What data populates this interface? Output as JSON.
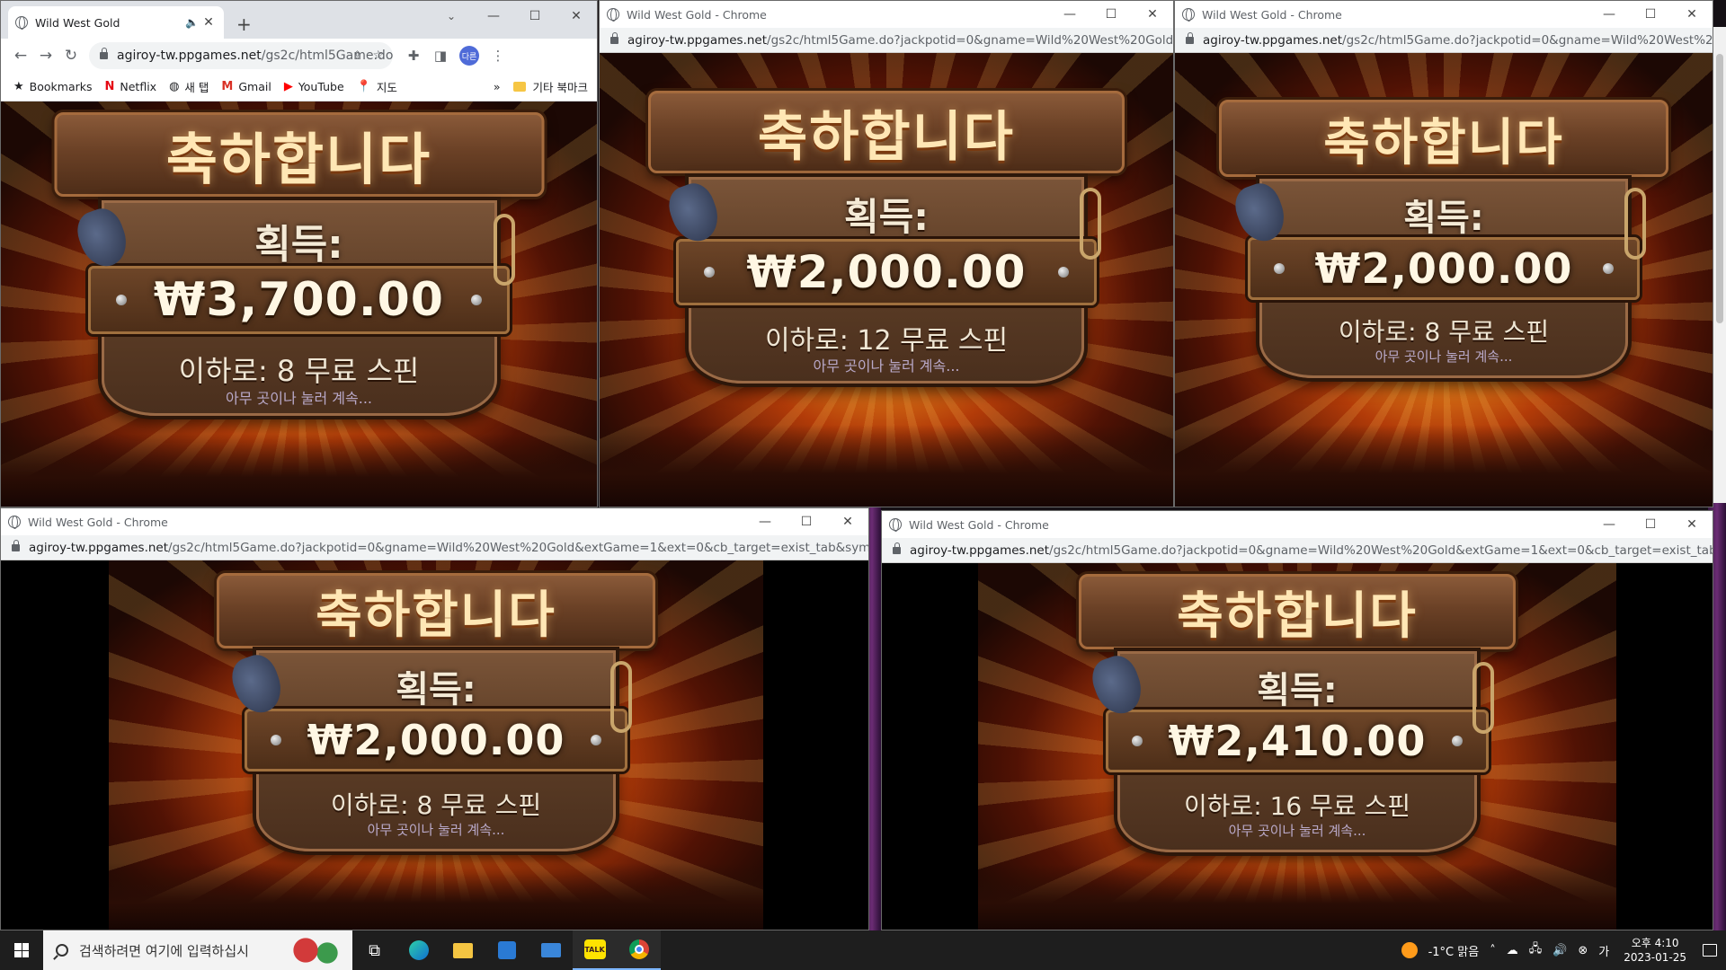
{
  "colors": {
    "taskbar": "#1e1e1e",
    "chrome_frame": "#dee1e6",
    "accent": "#4f6bd8"
  },
  "main_window": {
    "tab_title": "Wild West Gold",
    "url_domain": "agiroy-tw.ppgames.net",
    "url_path": "/gs2c/html5Game.do?ja...",
    "profile_initial": "다른",
    "bookmarks": [
      "Bookmarks",
      "Netflix",
      "새 탭",
      "Gmail",
      "YouTube",
      "지도"
    ],
    "bookmarks_overflow": "»",
    "other_bookmarks": "기타 북마크",
    "game": {
      "title": "축하합니다",
      "gain_label": "획득:",
      "amount": "₩3,700.00",
      "spins": "이하로: 8 무료 스핀",
      "continue": "아무 곳이나 눌러 계속..."
    }
  },
  "popups": [
    {
      "title": "Wild West Gold - Chrome",
      "url_domain": "agiroy-tw.ppgames.net",
      "url_path": "/gs2c/html5Game.do?jackpotid=0&gname=Wild%20West%20Gold...",
      "game": {
        "title": "축하합니다",
        "gain_label": "획득:",
        "amount": "₩2,000.00",
        "spins": "이하로: 12 무료 스핀",
        "continue": "아무 곳이나 눌러 계속..."
      }
    },
    {
      "title": "Wild West Gold - Chrome",
      "url_domain": "agiroy-tw.ppgames.net",
      "url_path": "/gs2c/html5Game.do?jackpotid=0&gname=Wild%20West%2...",
      "game": {
        "title": "축하합니다",
        "gain_label": "획득:",
        "amount": "₩2,000.00",
        "spins": "이하로: 8 무료 스핀",
        "continue": "아무 곳이나 눌러 계속..."
      }
    },
    {
      "title": "Wild West Gold - Chrome",
      "url_domain": "agiroy-tw.ppgames.net",
      "url_path": "/gs2c/html5Game.do?jackpotid=0&gname=Wild%20West%20Gold&extGame=1&ext=0&cb_target=exist_tab&symbol=...",
      "game": {
        "title": "축하합니다",
        "gain_label": "획득:",
        "amount": "₩2,000.00",
        "spins": "이하로: 8 무료 스핀",
        "continue": "아무 곳이나 눌러 계속..."
      }
    },
    {
      "title": "Wild West Gold - Chrome",
      "url_domain": "agiroy-tw.ppgames.net",
      "url_path": "/gs2c/html5Game.do?jackpotid=0&gname=Wild%20West%20Gold&extGame=1&ext=0&cb_target=exist_tab&sy...",
      "game": {
        "title": "축하합니다",
        "gain_label": "획득:",
        "amount": "₩2,410.00",
        "spins": "이하로: 16 무료 스핀",
        "continue": "아무 곳이나 눌러 계속..."
      }
    }
  ],
  "taskbar": {
    "search_placeholder": "검색하려면 여기에 입력하십시",
    "talk_label": "TALK",
    "weather": "-1°C  맑음",
    "time": "오후 4:10",
    "date": "2023-01-25",
    "ime": "가"
  }
}
